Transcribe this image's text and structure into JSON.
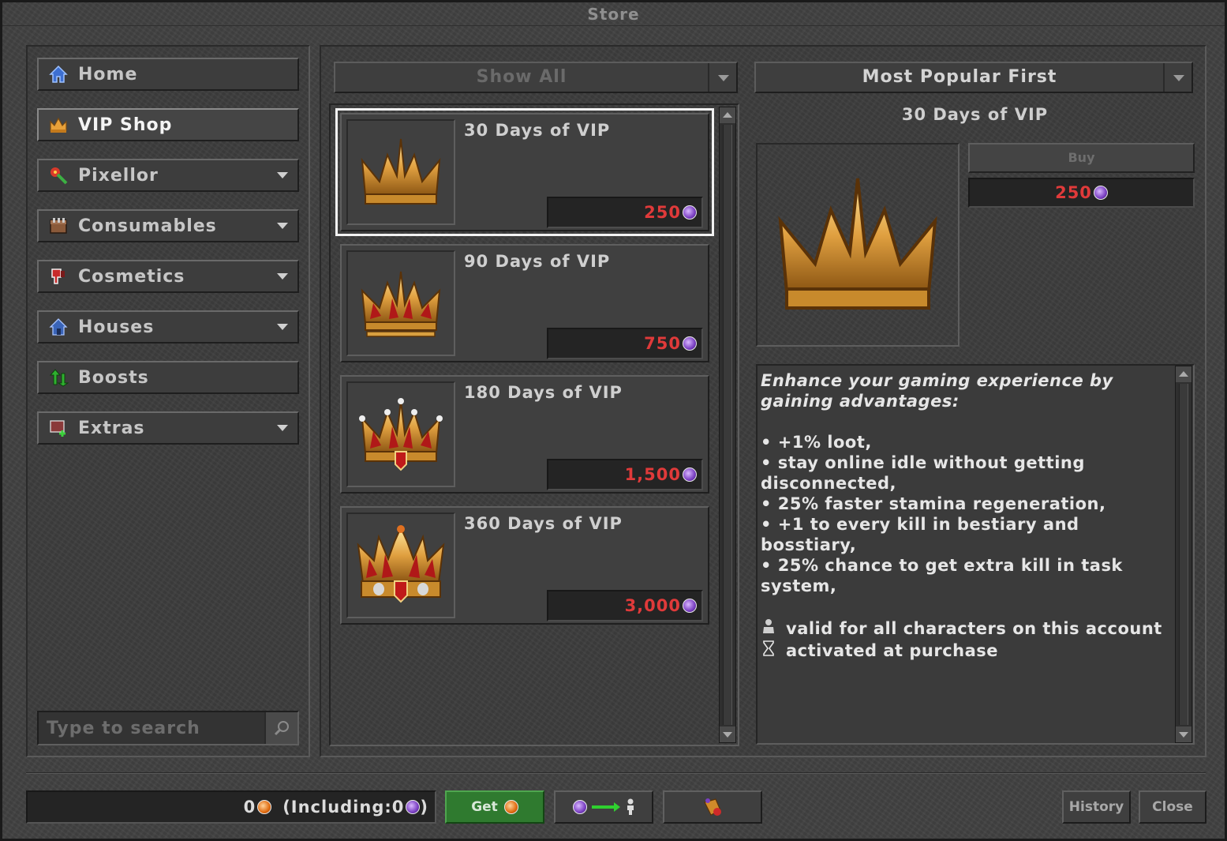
{
  "window": {
    "title": "Store"
  },
  "sidebar": {
    "items": [
      {
        "label": "Home",
        "icon": "home-icon",
        "has_submenu": false,
        "active": false
      },
      {
        "label": "VIP Shop",
        "icon": "crown-icon",
        "has_submenu": false,
        "active": true
      },
      {
        "label": "Pixellor",
        "icon": "pixellor-icon",
        "has_submenu": true,
        "active": false
      },
      {
        "label": "Consumables",
        "icon": "chest-icon",
        "has_submenu": true,
        "active": false
      },
      {
        "label": "Cosmetics",
        "icon": "cosmetics-icon",
        "has_submenu": true,
        "active": false
      },
      {
        "label": "Houses",
        "icon": "house-icon",
        "has_submenu": true,
        "active": false
      },
      {
        "label": "Boosts",
        "icon": "boost-arrows-icon",
        "has_submenu": false,
        "active": false
      },
      {
        "label": "Extras",
        "icon": "extras-icon",
        "has_submenu": true,
        "active": false
      }
    ],
    "search": {
      "placeholder": "Type to search",
      "value": ""
    }
  },
  "filters": {
    "show": {
      "label": "Show All",
      "enabled": false
    },
    "sort": {
      "label": "Most Popular First",
      "enabled": true
    }
  },
  "offers": [
    {
      "name": "30 Days of VIP",
      "price": "250",
      "selected": true,
      "icon": "crown-gold-icon"
    },
    {
      "name": "90 Days of VIP",
      "price": "750",
      "selected": false,
      "icon": "crown-ruby-icon"
    },
    {
      "name": "180 Days of VIP",
      "price": "1,500",
      "selected": false,
      "icon": "crown-jeweled-icon"
    },
    {
      "name": "360 Days of VIP",
      "price": "3,000",
      "selected": false,
      "icon": "crown-royal-icon"
    }
  ],
  "detail": {
    "title": "30 Days of VIP",
    "buy_label": "Buy",
    "price": "250",
    "intro": "Enhance your gaming experience by gaining advantages:",
    "bullets": [
      "• +1% loot,",
      "• stay online idle without getting disconnected,",
      "• 25% faster stamina regeneration,",
      "• +1 to every kill in bestiary and bosstiary,",
      "• 25% chance to get extra kill in task system,"
    ],
    "notes": [
      {
        "icon": "character-icon",
        "text": "valid for all characters on this account"
      },
      {
        "icon": "hourglass-icon",
        "text": "activated at purchase"
      }
    ]
  },
  "footer": {
    "balance": "0",
    "including_label": "(Including:",
    "including_value": "0",
    "including_close": ")",
    "get_label": "Get",
    "history_label": "History",
    "close_label": "Close"
  },
  "colors": {
    "price_red": "#e03a3a",
    "get_green": "#2f7a2f",
    "coin_purple": "#7a3fc2",
    "coin_orange": "#e06b10"
  }
}
